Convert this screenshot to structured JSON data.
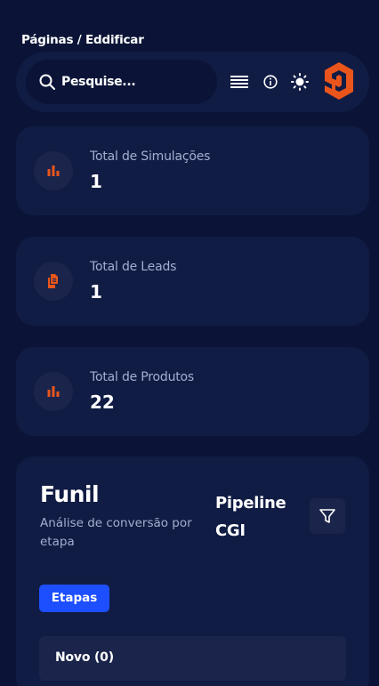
{
  "breadcrumb": "Páginas / Eddificar",
  "search": {
    "placeholder": "Pesquise..."
  },
  "colors": {
    "background": "#0b1437",
    "card": "#111c44",
    "accent": "#e9551b",
    "primary": "#1d4fff",
    "muted": "#a3aed0"
  },
  "icons": [
    "search-icon",
    "menu-lines-icon",
    "info-icon",
    "sun-icon",
    "brand-logo-icon"
  ],
  "stats": [
    {
      "label": "Total de Simulações",
      "value": "1",
      "icon": "bar-chart-icon"
    },
    {
      "label": "Total de Leads",
      "value": "1",
      "icon": "documents-icon"
    },
    {
      "label": "Total de Produtos",
      "value": "22",
      "icon": "bar-chart-icon"
    }
  ],
  "funnel": {
    "title": "Funil",
    "subtitle": "Análise de conversão por etapa",
    "pipeline": "Pipeline CGI",
    "badge": "Etapas",
    "stages": [
      {
        "label": "Novo (0)"
      }
    ]
  }
}
